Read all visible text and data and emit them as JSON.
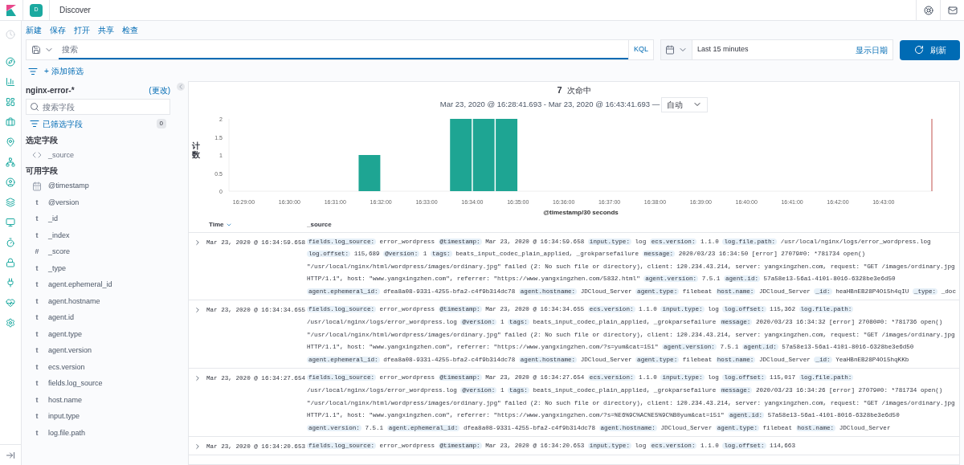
{
  "header": {
    "space_badge": "D",
    "title": "Discover"
  },
  "menu": [
    "新建",
    "保存",
    "打开",
    "共享",
    "检查"
  ],
  "query": {
    "placeholder": "搜索",
    "language": "KQL"
  },
  "time": {
    "range": "Last 15 minutes",
    "show_dates": "显示日期",
    "refresh": "刷新"
  },
  "filter": {
    "add": "+ 添加筛选"
  },
  "sidebar": {
    "index_pattern": "nginx-error-*",
    "change": "(更改)",
    "search_placeholder": "搜索字段",
    "filtered_label": "已筛选字段",
    "filtered_count": "0",
    "selected_heading": "选定字段",
    "selected_fields": [
      {
        "name": "_source",
        "kind": "source"
      }
    ],
    "available_heading": "可用字段",
    "available_fields": [
      {
        "name": "@timestamp",
        "kind": "date"
      },
      {
        "name": "@version",
        "kind": "text",
        "type_label": "t"
      },
      {
        "name": "_id",
        "kind": "text",
        "type_label": "t"
      },
      {
        "name": "_index",
        "kind": "text",
        "type_label": "t"
      },
      {
        "name": "_score",
        "kind": "text",
        "type_label": "#"
      },
      {
        "name": "_type",
        "kind": "text",
        "type_label": "t"
      },
      {
        "name": "agent.ephemeral_id",
        "kind": "text",
        "type_label": "t"
      },
      {
        "name": "agent.hostname",
        "kind": "text",
        "type_label": "t"
      },
      {
        "name": "agent.id",
        "kind": "text",
        "type_label": "t"
      },
      {
        "name": "agent.type",
        "kind": "text",
        "type_label": "t"
      },
      {
        "name": "agent.version",
        "kind": "text",
        "type_label": "t"
      },
      {
        "name": "ecs.version",
        "kind": "text",
        "type_label": "t"
      },
      {
        "name": "fields.log_source",
        "kind": "text",
        "type_label": "t"
      },
      {
        "name": "host.name",
        "kind": "text",
        "type_label": "t"
      },
      {
        "name": "input.type",
        "kind": "text",
        "type_label": "t"
      },
      {
        "name": "log.file.path",
        "kind": "text",
        "type_label": "t"
      }
    ]
  },
  "histogram": {
    "hits": "7",
    "hits_label": "次命中",
    "range": "Mar 23, 2020 @ 16:28:41.693 - Mar 23, 2020 @ 16:43:41.693 —",
    "interval": "自动",
    "chart_data": {
      "type": "bar",
      "xlabel": "@timestamp/30 seconds",
      "ylabel": "计数",
      "categories": [
        null,
        "16:29:00",
        null,
        "16:30:00",
        null,
        "16:31:00",
        null,
        "16:32:00",
        null,
        "16:33:00",
        null,
        "16:34:00",
        null,
        "16:35:00",
        null,
        "16:36:00",
        null,
        "16:37:00",
        null,
        "16:38:00",
        null,
        "16:39:00",
        null,
        "16:40:00",
        null,
        "16:41:00",
        null,
        "16:42:00",
        null,
        "16:43:00",
        null
      ],
      "series": [
        {
          "color": "#1ea593",
          "values": [
            0,
            0,
            0,
            0,
            0,
            0,
            1,
            0,
            0,
            0,
            2,
            2,
            2,
            0,
            0,
            0,
            0,
            0,
            0,
            0,
            0,
            0,
            0,
            0,
            0,
            0,
            0,
            0,
            0,
            0,
            0
          ]
        }
      ],
      "ylim": [
        0,
        2
      ],
      "yticks": [
        0,
        0.5,
        1,
        1.5,
        2
      ]
    }
  },
  "table": {
    "columns": [
      "Time",
      "_source"
    ],
    "rows": [
      {
        "time": "Mar 23, 2020 @ 16:34:59.658",
        "expanded": false,
        "fields": [
          {
            "key": "fields.log_source:",
            "value": "error_wordpress"
          },
          {
            "key": "@timestamp:",
            "value": "Mar 23, 2020 @ 16:34:59.658"
          },
          {
            "key": "input.type:",
            "value": "log"
          },
          {
            "key": "ecs.version:",
            "value": "1.1.0"
          },
          {
            "key": "log.file.path:",
            "value": "/usr/local/nginx/logs/error_wordpress.log"
          },
          {
            "key": "log.offset:",
            "value": "115,689"
          },
          {
            "key": "@version:",
            "value": "1"
          },
          {
            "key": "tags:",
            "value": "beats_input_codec_plain_applied, _grokparsefailure"
          },
          {
            "key": "message:",
            "value": "2020/03/23 16:34:50 [error] 27079#0: *781734 open() \"/usr/local/nginx/html/wordpress/images/ordinary.jpg\" failed (2: No such file or directory), client: 120.234.43.214, server: yangxingzhen.com, request: \"GET /images/ordinary.jpg HTTP/1.1\", host: \"www.yangxingzhen.com\", referrer: \"https://www.yangxingzhen.com/5832.html\""
          },
          {
            "key": "agent.version:",
            "value": "7.5.1"
          },
          {
            "key": "agent.id:",
            "value": "57a58e13-56a1-4101-8016-6328be3e6d50"
          },
          {
            "key": "agent.ephemeral_id:",
            "value": "dfea8a08-9331-4255-bfa2-c4f9b314dc78"
          },
          {
            "key": "agent.hostname:",
            "value": "JDCloud_Server"
          },
          {
            "key": "agent.type:",
            "value": "filebeat"
          },
          {
            "key": "host.name:",
            "value": "JDCloud_Server"
          },
          {
            "key": "_id:",
            "value": "heaHBnEB28P4O15h4qIU"
          },
          {
            "key": "_type:",
            "value": "_doc"
          }
        ]
      },
      {
        "time": "Mar 23, 2020 @ 16:34:34.655",
        "expanded": false,
        "fields": [
          {
            "key": "fields.log_source:",
            "value": "error_wordpress"
          },
          {
            "key": "@timestamp:",
            "value": "Mar 23, 2020 @ 16:34:34.655"
          },
          {
            "key": "ecs.version:",
            "value": "1.1.0"
          },
          {
            "key": "input.type:",
            "value": "log"
          },
          {
            "key": "log.offset:",
            "value": "115,362"
          },
          {
            "key": "log.file.path:",
            "value": "/usr/local/nginx/logs/error_wordpress.log"
          },
          {
            "key": "@version:",
            "value": "1"
          },
          {
            "key": "tags:",
            "value": "beats_input_codec_plain_applied, _grokparsefailure"
          },
          {
            "key": "message:",
            "value": "2020/03/23 16:34:32 [error] 27080#0: *781736 open() \"/usr/local/nginx/html/wordpress/images/ordinary.jpg\" failed (2: No such file or directory), client: 120.234.43.214, server: yangxingzhen.com, request: \"GET /images/ordinary.jpg HTTP/1.1\", host: \"www.yangxingzhen.com\", referrer: \"https://www.yangxingzhen.com/?s=yum&cat=151\""
          },
          {
            "key": "agent.version:",
            "value": "7.5.1"
          },
          {
            "key": "agent.id:",
            "value": "57a58e13-56a1-4101-8016-6328be3e6d50"
          },
          {
            "key": "agent.ephemeral_id:",
            "value": "dfea8a08-9331-4255-bfa2-c4f9b314dc78"
          },
          {
            "key": "agent.hostname:",
            "value": "JDCloud_Server"
          },
          {
            "key": "agent.type:",
            "value": "filebeat"
          },
          {
            "key": "host.name:",
            "value": "JDCloud_Server"
          },
          {
            "key": "_id:",
            "value": "YeaHBnEB28P4O15hqKKb"
          }
        ]
      },
      {
        "time": "Mar 23, 2020 @ 16:34:27.654",
        "expanded": false,
        "fields": [
          {
            "key": "fields.log_source:",
            "value": "error_wordpress"
          },
          {
            "key": "@timestamp:",
            "value": "Mar 23, 2020 @ 16:34:27.654"
          },
          {
            "key": "ecs.version:",
            "value": "1.1.0"
          },
          {
            "key": "input.type:",
            "value": "log"
          },
          {
            "key": "log.offset:",
            "value": "115,017"
          },
          {
            "key": "log.file.path:",
            "value": "/usr/local/nginx/logs/error_wordpress.log"
          },
          {
            "key": "@version:",
            "value": "1"
          },
          {
            "key": "tags:",
            "value": "beats_input_codec_plain_applied, _grokparsefailure"
          },
          {
            "key": "message:",
            "value": "2020/03/23 16:34:26 [error] 27079#0: *781734 open() \"/usr/local/nginx/html/wordpress/images/ordinary.jpg\" failed (2: No such file or directory), client: 120.234.43.214, server: yangxingzhen.com, request: \"GET /images/ordinary.jpg HTTP/1.1\", host: \"www.yangxingzhen.com\", referrer: \"https://www.yangxingzhen.com/?s=%E6%9C%AC%E5%9C%B0yum&cat=151\""
          },
          {
            "key": "agent.id:",
            "value": "57a58e13-56a1-4101-8016-6328be3e6d50"
          },
          {
            "key": "agent.version:",
            "value": "7.5.1"
          },
          {
            "key": "agent.ephemeral_id:",
            "value": "dfea8a08-9331-4255-bfa2-c4f9b314dc78"
          },
          {
            "key": "agent.hostname:",
            "value": "JDCloud_Server"
          },
          {
            "key": "agent.type:",
            "value": "filebeat"
          },
          {
            "key": "host.name:",
            "value": "JDCloud_Server"
          }
        ]
      },
      {
        "time": "Mar 23, 2020 @ 16:34:20.653",
        "expanded": false,
        "fields": [
          {
            "key": "fields.log_source:",
            "value": "error_wordpress"
          },
          {
            "key": "@timestamp:",
            "value": "Mar 23, 2020 @ 16:34:20.653"
          },
          {
            "key": "input.type:",
            "value": "log"
          },
          {
            "key": "ecs.version:",
            "value": "1.1.0"
          },
          {
            "key": "log.offset:",
            "value": "114,663"
          }
        ]
      }
    ]
  }
}
